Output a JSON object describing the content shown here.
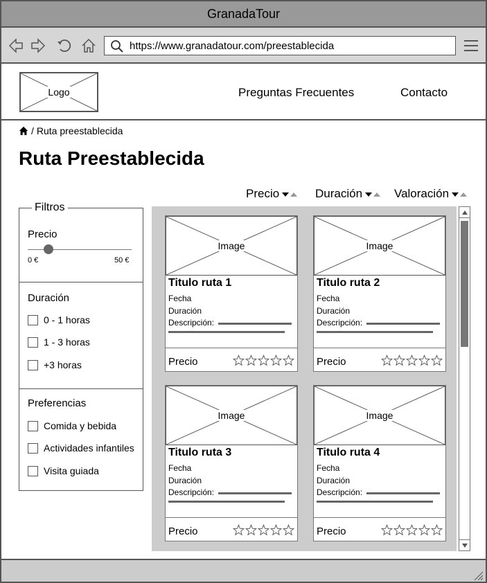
{
  "window": {
    "title": "GranadaTour"
  },
  "browser": {
    "url": "https://www.granadatour.com/preestablecida",
    "icons": [
      "back-icon",
      "forward-icon",
      "reload-icon",
      "home-icon",
      "search-icon",
      "hamburger-menu-icon"
    ]
  },
  "header": {
    "logo_label": "Logo",
    "nav": [
      {
        "label": "Preguntas Frecuentes"
      },
      {
        "label": "Contacto"
      }
    ]
  },
  "breadcrumb": {
    "separator": "/",
    "current": "Ruta preestablecida"
  },
  "page": {
    "title": "Ruta Preestablecida"
  },
  "sort": [
    {
      "label": "Precio"
    },
    {
      "label": "Duración"
    },
    {
      "label": "Valoración"
    }
  ],
  "filters": {
    "legend": "Filtros",
    "price": {
      "heading": "Precio",
      "min_label": "0 €",
      "max_label": "50 €",
      "value_fraction": 0.2
    },
    "duration": {
      "heading": "Duración",
      "options": [
        {
          "label": "0 - 1 horas",
          "checked": false
        },
        {
          "label": "1 - 3 horas",
          "checked": false
        },
        {
          "label": "+3 horas",
          "checked": false
        }
      ]
    },
    "preferences": {
      "heading": "Preferencias",
      "options": [
        {
          "label": "Comida y bebida",
          "checked": false
        },
        {
          "label": "Actividades infantiles",
          "checked": false
        },
        {
          "label": "Visita guiada",
          "checked": false
        }
      ]
    }
  },
  "routes": [
    {
      "image_label": "Image",
      "title": "Titulo ruta 1",
      "date_label": "Fecha",
      "duration_label": "Duración",
      "description_label": "Descripción:",
      "price_label": "Precio",
      "rating": 0
    },
    {
      "image_label": "Image",
      "title": "Titulo ruta 2",
      "date_label": "Fecha",
      "duration_label": "Duración",
      "description_label": "Descripción:",
      "price_label": "Precio",
      "rating": 0
    },
    {
      "image_label": "Image",
      "title": "Titulo ruta 3",
      "date_label": "Fecha",
      "duration_label": "Duración",
      "description_label": "Descripción:",
      "price_label": "Precio",
      "rating": 0
    },
    {
      "image_label": "Image",
      "title": "Titulo ruta 4",
      "date_label": "Fecha",
      "duration_label": "Duración",
      "description_label": "Descripción:",
      "price_label": "Precio",
      "rating": 0
    }
  ],
  "colors": {
    "frame": "#555555",
    "titlebar": "#999999",
    "toolbar": "#d6d6d6",
    "results_bg": "#cccccc"
  }
}
